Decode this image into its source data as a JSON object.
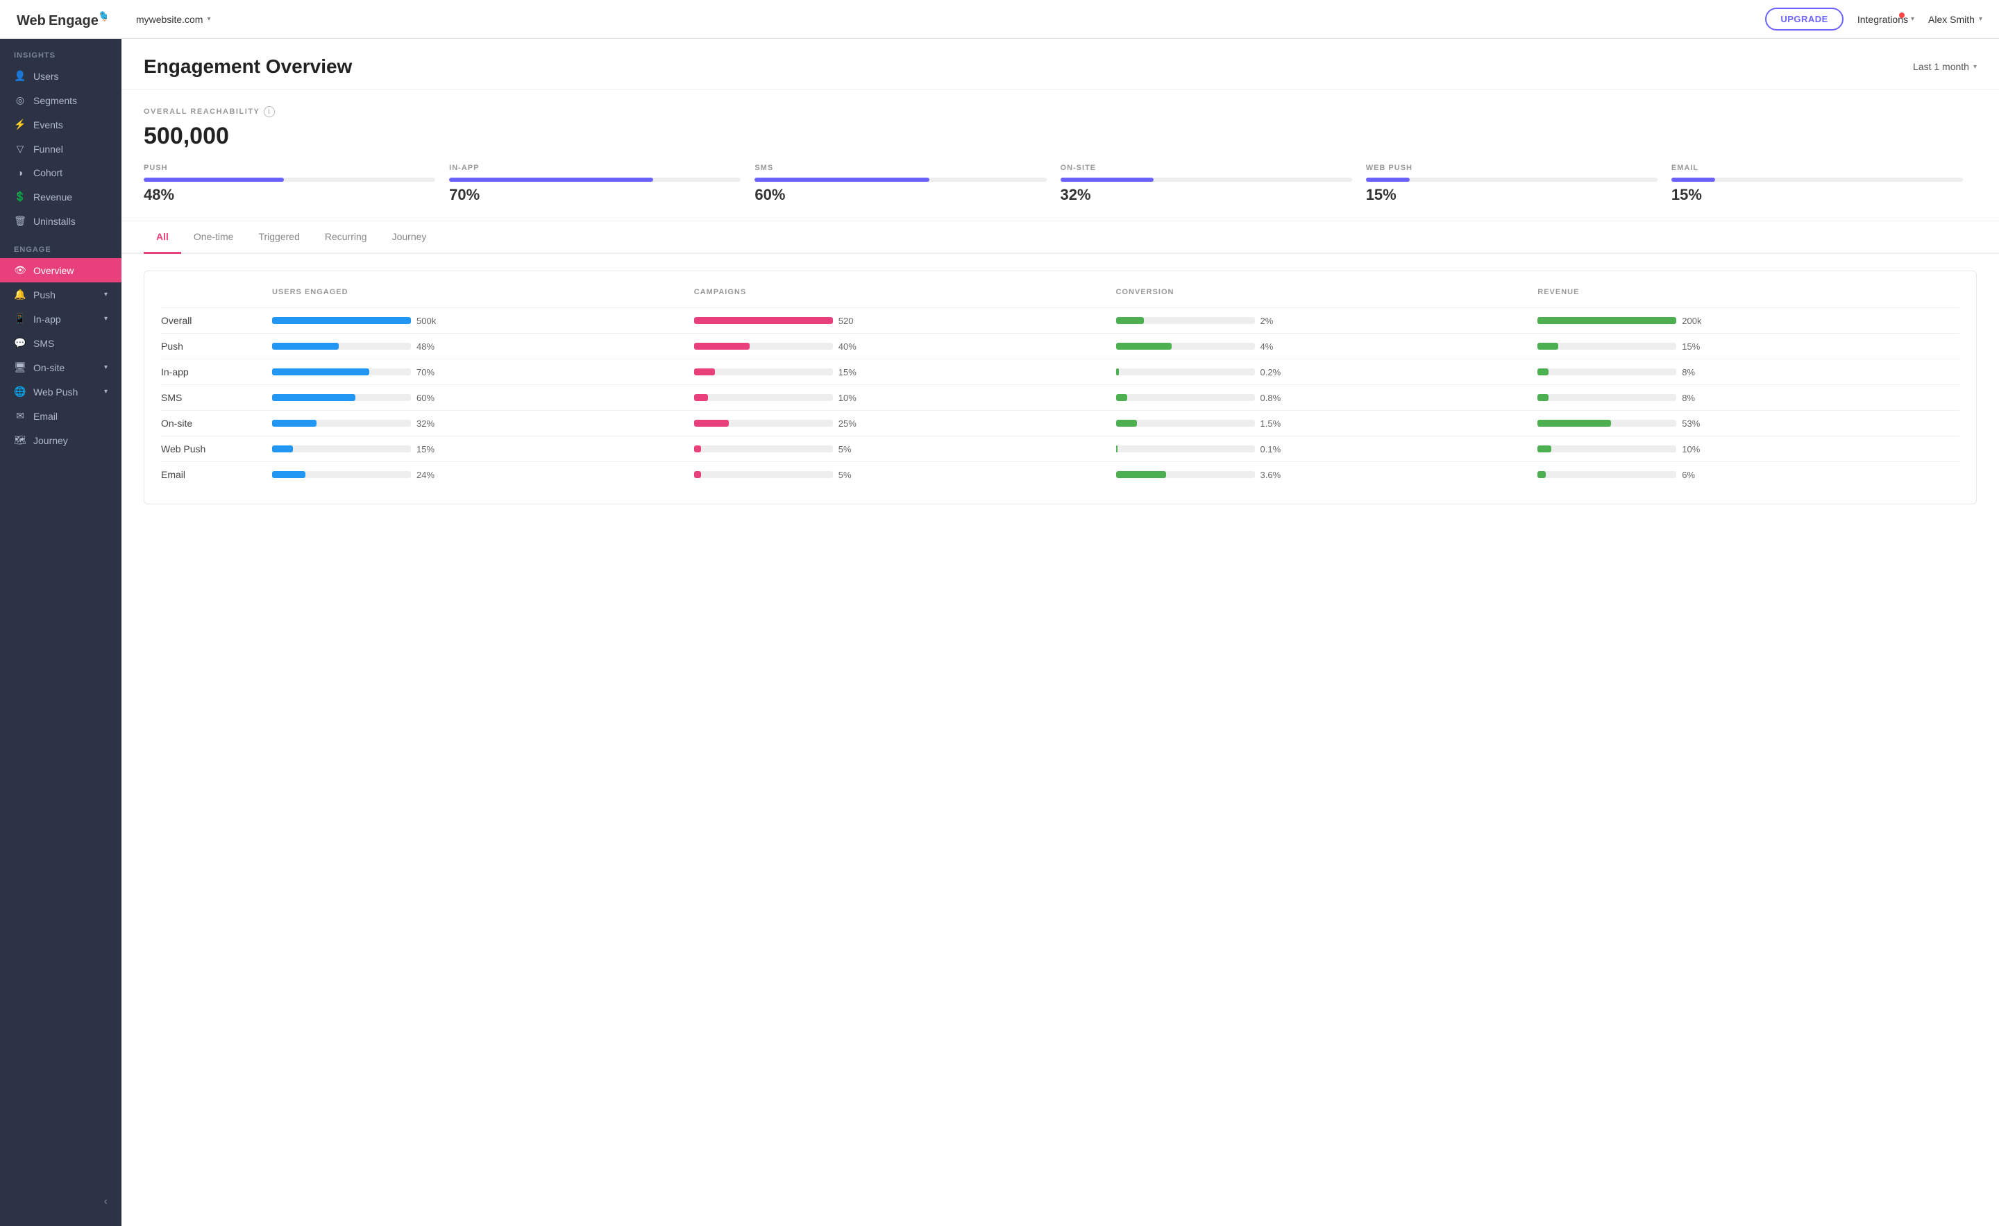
{
  "topnav": {
    "logo": "WebEngage",
    "website": "mywebsite.com",
    "upgrade_label": "UPGRADE",
    "integrations_label": "Integrations",
    "user_name": "Alex Smith"
  },
  "sidebar": {
    "insights_label": "INSIGHTS",
    "engage_label": "ENGAGE",
    "items_insights": [
      {
        "id": "users",
        "label": "Users",
        "icon": "👤"
      },
      {
        "id": "segments",
        "label": "Segments",
        "icon": "◎"
      },
      {
        "id": "events",
        "label": "Events",
        "icon": "⚡"
      },
      {
        "id": "funnel",
        "label": "Funnel",
        "icon": "▽"
      },
      {
        "id": "cohort",
        "label": "Cohort",
        "icon": "◑"
      },
      {
        "id": "revenue",
        "label": "Revenue",
        "icon": "💲"
      },
      {
        "id": "uninstalls",
        "label": "Uninstalls",
        "icon": "🗑"
      }
    ],
    "items_engage": [
      {
        "id": "overview",
        "label": "Overview",
        "icon": "👁",
        "active": true
      },
      {
        "id": "push",
        "label": "Push",
        "icon": "🔔",
        "arrow": true
      },
      {
        "id": "inapp",
        "label": "In-app",
        "icon": "📱",
        "arrow": true
      },
      {
        "id": "sms",
        "label": "SMS",
        "icon": "💬"
      },
      {
        "id": "onsite",
        "label": "On-site",
        "icon": "🖥",
        "arrow": true
      },
      {
        "id": "webpush",
        "label": "Web Push",
        "icon": "🌐",
        "arrow": true
      },
      {
        "id": "email",
        "label": "Email",
        "icon": "✉"
      },
      {
        "id": "journey",
        "label": "Journey",
        "icon": "🗺"
      }
    ]
  },
  "page": {
    "title": "Engagement Overview",
    "date_filter": "Last 1 month"
  },
  "reachability": {
    "label": "OVERALL REACHABILITY",
    "total": "500,000",
    "channels": [
      {
        "id": "push",
        "label": "PUSH",
        "pct": "48%",
        "fill_pct": 48,
        "color": "#6c63ff"
      },
      {
        "id": "inapp",
        "label": "IN-APP",
        "pct": "70%",
        "fill_pct": 70,
        "color": "#6c63ff"
      },
      {
        "id": "sms",
        "label": "SMS",
        "pct": "60%",
        "fill_pct": 60,
        "color": "#6c63ff"
      },
      {
        "id": "onsite",
        "label": "ON-SITE",
        "pct": "32%",
        "fill_pct": 32,
        "color": "#6c63ff"
      },
      {
        "id": "webpush",
        "label": "WEB PUSH",
        "pct": "15%",
        "fill_pct": 15,
        "color": "#6c63ff"
      },
      {
        "id": "email",
        "label": "EMAIL",
        "pct": "15%",
        "fill_pct": 15,
        "color": "#6c63ff"
      }
    ]
  },
  "tabs": [
    {
      "id": "all",
      "label": "All",
      "active": true
    },
    {
      "id": "onetime",
      "label": "One-time",
      "active": false
    },
    {
      "id": "triggered",
      "label": "Triggered",
      "active": false
    },
    {
      "id": "recurring",
      "label": "Recurring",
      "active": false
    },
    {
      "id": "journey",
      "label": "Journey",
      "active": false
    }
  ],
  "table": {
    "col_headers": [
      "",
      "USERS ENGAGED",
      "CAMPAIGNS",
      "CONVERSION",
      "REVENUE"
    ],
    "rows": [
      {
        "label": "Overall",
        "users_val": "500k",
        "users_pct": 100,
        "users_color": "#2196F3",
        "campaigns_val": "520",
        "campaigns_pct": 100,
        "campaigns_color": "#e8407a",
        "conversion_val": "2%",
        "conversion_pct": 20,
        "conversion_color": "#4caf50",
        "revenue_val": "200k",
        "revenue_pct": 100,
        "revenue_color": "#4caf50"
      },
      {
        "label": "Push",
        "users_val": "48%",
        "users_pct": 48,
        "users_color": "#2196F3",
        "campaigns_val": "40%",
        "campaigns_pct": 40,
        "campaigns_color": "#e8407a",
        "conversion_val": "4%",
        "conversion_pct": 40,
        "conversion_color": "#4caf50",
        "revenue_val": "15%",
        "revenue_pct": 15,
        "revenue_color": "#4caf50"
      },
      {
        "label": "In-app",
        "users_val": "70%",
        "users_pct": 70,
        "users_color": "#2196F3",
        "campaigns_val": "15%",
        "campaigns_pct": 15,
        "campaigns_color": "#e8407a",
        "conversion_val": "0.2%",
        "conversion_pct": 2,
        "conversion_color": "#4caf50",
        "revenue_val": "8%",
        "revenue_pct": 8,
        "revenue_color": "#4caf50"
      },
      {
        "label": "SMS",
        "users_val": "60%",
        "users_pct": 60,
        "users_color": "#2196F3",
        "campaigns_val": "10%",
        "campaigns_pct": 10,
        "campaigns_color": "#e8407a",
        "conversion_val": "0.8%",
        "conversion_pct": 8,
        "conversion_color": "#4caf50",
        "revenue_val": "8%",
        "revenue_pct": 8,
        "revenue_color": "#4caf50"
      },
      {
        "label": "On-site",
        "users_val": "32%",
        "users_pct": 32,
        "users_color": "#2196F3",
        "campaigns_val": "25%",
        "campaigns_pct": 25,
        "campaigns_color": "#e8407a",
        "conversion_val": "1.5%",
        "conversion_pct": 15,
        "conversion_color": "#4caf50",
        "revenue_val": "53%",
        "revenue_pct": 53,
        "revenue_color": "#4caf50"
      },
      {
        "label": "Web Push",
        "users_val": "15%",
        "users_pct": 15,
        "users_color": "#2196F3",
        "campaigns_val": "5%",
        "campaigns_pct": 5,
        "campaigns_color": "#e8407a",
        "conversion_val": "0.1%",
        "conversion_pct": 1,
        "conversion_color": "#4caf50",
        "revenue_val": "10%",
        "revenue_pct": 10,
        "revenue_color": "#4caf50"
      },
      {
        "label": "Email",
        "users_val": "24%",
        "users_pct": 24,
        "users_color": "#2196F3",
        "campaigns_val": "5%",
        "campaigns_pct": 5,
        "campaigns_color": "#e8407a",
        "conversion_val": "3.6%",
        "conversion_pct": 36,
        "conversion_color": "#4caf50",
        "revenue_val": "6%",
        "revenue_pct": 6,
        "revenue_color": "#4caf50"
      }
    ]
  }
}
